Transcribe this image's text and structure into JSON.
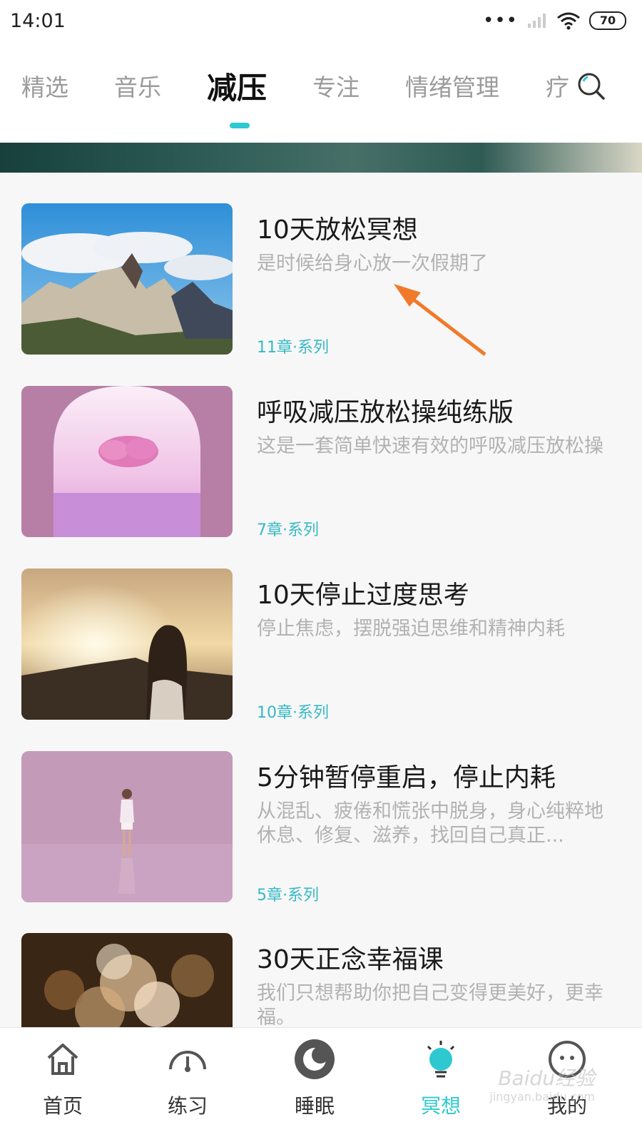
{
  "status_bar": {
    "time": "14:01",
    "battery": "70"
  },
  "tabs": [
    {
      "label": "精选",
      "active": false
    },
    {
      "label": "音乐",
      "active": false
    },
    {
      "label": "减压",
      "active": true
    },
    {
      "label": "专注",
      "active": false
    },
    {
      "label": "情绪管理",
      "active": false
    },
    {
      "label": "疗",
      "active": false
    }
  ],
  "accent_color": "#2ec9d0",
  "items": [
    {
      "title": "10天放松冥想",
      "description": "是时候给身心放一次假期了",
      "meta": "11章·系列"
    },
    {
      "title": "呼吸减压放松操纯练版",
      "description": "这是一套简单快速有效的呼吸减压放松操",
      "meta": "7章·系列"
    },
    {
      "title": "10天停止过度思考",
      "description": "停止焦虑，摆脱强迫思维和精神内耗",
      "meta": "10章·系列"
    },
    {
      "title": "5分钟暂停重启，停止内耗",
      "description": "从混乱、疲倦和慌张中脱身，身心纯粹地休息、修复、滋养，找回自己真正...",
      "meta": "5章·系列"
    },
    {
      "title": "30天正念幸福课",
      "description": "我们只想帮助你把自己变得更美好，更幸福。",
      "meta": ""
    }
  ],
  "bottom_nav": [
    {
      "label": "首页",
      "icon": "home-icon",
      "active": false
    },
    {
      "label": "练习",
      "icon": "gauge-icon",
      "active": false
    },
    {
      "label": "睡眠",
      "icon": "moon-icon",
      "active": false
    },
    {
      "label": "冥想",
      "icon": "meditation-bulb-icon",
      "active": true
    },
    {
      "label": "我的",
      "icon": "smiley-face-icon",
      "active": false
    }
  ],
  "watermark": {
    "text": "Baidu经验",
    "sub": "jingyan.baidu.com"
  }
}
